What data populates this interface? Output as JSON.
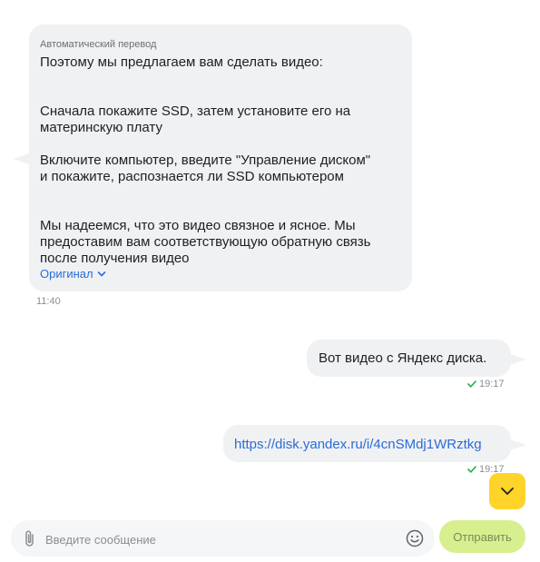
{
  "incoming_message": {
    "auto_translate_label": "Автоматический перевод",
    "text": "Поэтому мы предлагаем вам сделать видео:\n\n\nСначала покажите SSD, затем установите его на\nматеринскую плату\n\nВключите компьютер, введите \"Управление диском\"\nи покажите, распознается ли SSD компьютером\n\n\nМы надеемся, что это видео связное и ясное. Мы\nпредоставим вам соответствующую обратную связь\nпосле получения видео",
    "original_link": "Оригинал",
    "time": "11:40"
  },
  "outgoing_messages": [
    {
      "text": "Вот видео с Яндекс диска.",
      "time": "19:17"
    },
    {
      "link": "https://disk.yandex.ru/i/4cnSMdj1WRztkg",
      "time": "19:17"
    }
  ],
  "composer": {
    "placeholder": "Введите сообщение",
    "send_label": "Отправить"
  },
  "colors": {
    "bubble": "#f0f1f3",
    "link": "#2a6cd6",
    "read_check": "#2bb24c",
    "scroll_button": "#fed42b",
    "send_button": "#d7ef8e"
  },
  "icons": {
    "attach": "paperclip-icon",
    "emoji": "smiley-icon",
    "scroll": "chevron-down-icon",
    "read": "check-icon"
  }
}
